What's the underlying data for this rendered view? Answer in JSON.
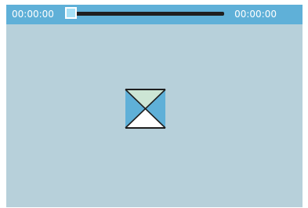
{
  "player": {
    "current_time": "00:00:00",
    "total_time": "00:00:00",
    "progress": 0
  },
  "loader": {
    "icon": "hourglass-icon"
  },
  "colors": {
    "controlbar": "#5fb0d8",
    "video_background": "#b7d0da",
    "thumb": "#a6e0f6",
    "track": "#1f1f1f",
    "hourglass_top": "#cde6d5",
    "hourglass_sides": "#5fb0d8",
    "hourglass_bottom": "#ffffff"
  }
}
